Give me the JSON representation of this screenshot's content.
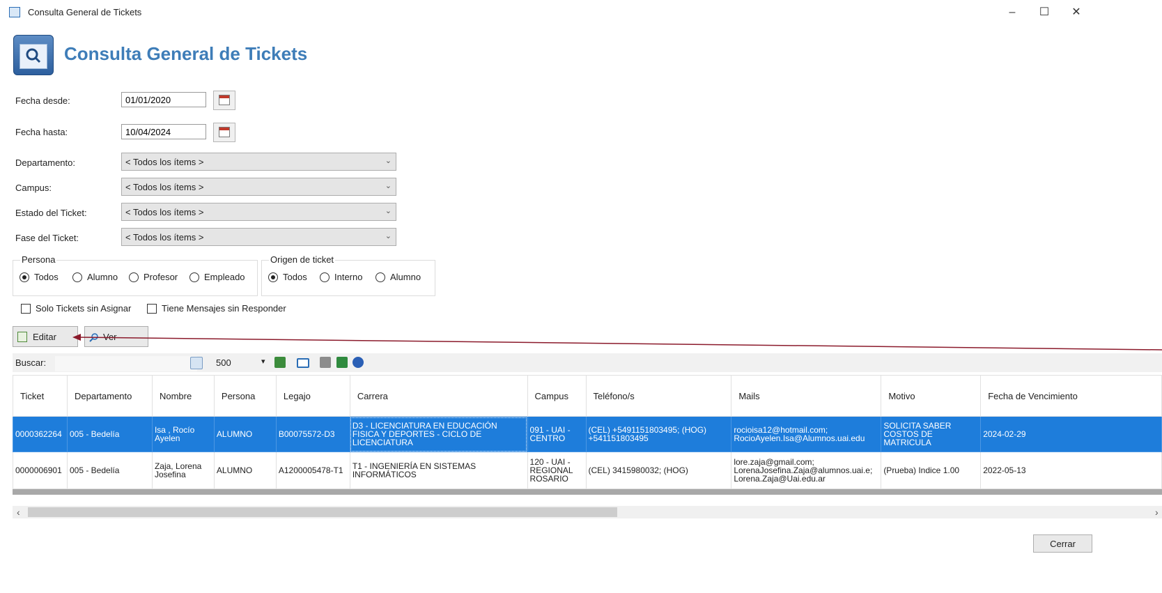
{
  "window": {
    "title": "Consulta General de Tickets",
    "minimize": "–",
    "maximize": "☐",
    "close": "✕"
  },
  "header": {
    "title": "Consulta General de Tickets"
  },
  "filters": {
    "fecha_desde_label": "Fecha desde:",
    "fecha_desde_value": "01/01/2020",
    "fecha_hasta_label": "Fecha hasta:",
    "fecha_hasta_value": "10/04/2024",
    "departamento_label": "Departamento:",
    "departamento_value": "< Todos los ítems >",
    "campus_label": "Campus:",
    "campus_value": "< Todos los ítems >",
    "estado_label": "Estado del Ticket:",
    "estado_value": "< Todos los ítems >",
    "fase_label": "Fase del Ticket:",
    "fase_value": "< Todos los ítems >"
  },
  "persona_group": {
    "title": "Persona",
    "options": [
      "Todos",
      "Alumno",
      "Profesor",
      "Empleado"
    ],
    "selected": "Todos"
  },
  "origen_group": {
    "title": "Origen de ticket",
    "options": [
      "Todos",
      "Interno",
      "Alumno"
    ],
    "selected": "Todos"
  },
  "checks": {
    "sin_asignar": "Solo Tickets sin Asignar",
    "sin_responder": "Tiene Mensajes sin Responder"
  },
  "actions": {
    "editar": "Editar",
    "ver": "Ver"
  },
  "search": {
    "label": "Buscar:",
    "value": "",
    "count": "500"
  },
  "grid": {
    "columns": [
      "Ticket",
      "Departamento",
      "Nombre",
      "Persona",
      "Legajo",
      "Carrera",
      "Campus",
      "Teléfono/s",
      "Mails",
      "Motivo",
      "Fecha de Vencimiento"
    ],
    "rows": [
      [
        "0000362264",
        "005 - Bedelía",
        "Isa , Rocío Ayelen",
        "ALUMNO",
        "B00075572-D3",
        "D3 - LICENCIATURA EN EDUCACIÓN FISICA Y DEPORTES - CICLO DE LICENCIATURA",
        "091 - UAI - CENTRO",
        "(CEL) +5491151803495; (HOG) +541151803495",
        "rocioisa12@hotmail.com; RocioAyelen.Isa@Alumnos.uai.edu",
        "SOLICITA SABER COSTOS DE MATRICULA",
        "2024-02-29"
      ],
      [
        "0000006901",
        "005 - Bedelía",
        "Zaja, Lorena Josefina",
        "ALUMNO",
        "A1200005478-T1",
        "T1 - INGENIERÍA EN SISTEMAS INFORMÁTICOS",
        "120 - UAI - REGIONAL ROSARIO",
        "(CEL) 3415980032; (HOG)",
        "lore.zaja@gmail.com; LorenaJosefina.Zaja@alumnos.uai.e; Lorena.Zaja@Uai.edu.ar",
        "(Prueba) Indice 1.00",
        "2022-05-13"
      ]
    ],
    "selected_row": 0
  },
  "footer": {
    "close": "Cerrar"
  },
  "colors": {
    "accent": "#3e7db8",
    "selection": "#1e7ddb",
    "annotation_arrow": "#8b1a2b"
  },
  "icons": [
    "app-search-icon",
    "calendar-icon",
    "chevron-down-icon",
    "edit-icon",
    "magnifier-icon",
    "excel-icon",
    "print-icon",
    "help-icon"
  ]
}
